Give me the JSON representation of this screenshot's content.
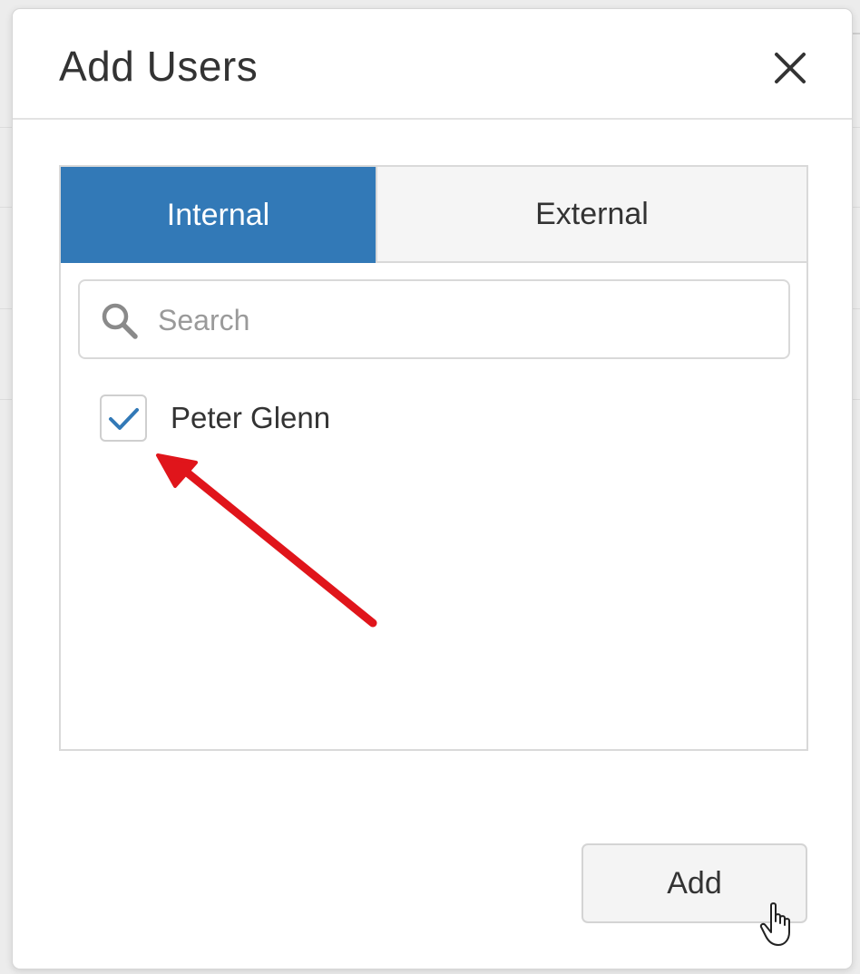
{
  "dialog": {
    "title": "Add Users",
    "close_icon": "close-icon"
  },
  "tabs": [
    {
      "label": "Internal",
      "active": true
    },
    {
      "label": "External",
      "active": false
    }
  ],
  "search": {
    "placeholder": "Search",
    "value": "",
    "icon": "search-icon"
  },
  "users": [
    {
      "name": "Peter Glenn",
      "checked": true
    }
  ],
  "footer": {
    "add_label": "Add"
  },
  "colors": {
    "accent": "#3279b7",
    "annotation_arrow": "#e0151b",
    "text": "#333333",
    "placeholder": "#9a9a9a"
  }
}
